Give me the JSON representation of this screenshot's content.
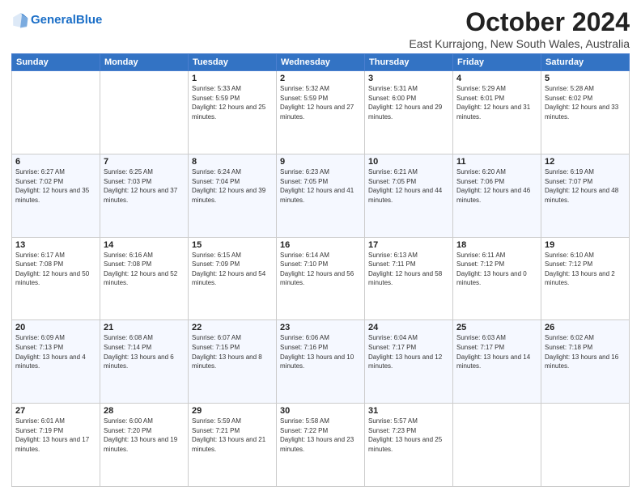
{
  "header": {
    "logo_line1": "General",
    "logo_line2": "Blue",
    "month_title": "October 2024",
    "location": "East Kurrajong, New South Wales, Australia"
  },
  "weekdays": [
    "Sunday",
    "Monday",
    "Tuesday",
    "Wednesday",
    "Thursday",
    "Friday",
    "Saturday"
  ],
  "weeks": [
    [
      {
        "day": "",
        "sunrise": "",
        "sunset": "",
        "daylight": ""
      },
      {
        "day": "",
        "sunrise": "",
        "sunset": "",
        "daylight": ""
      },
      {
        "day": "1",
        "sunrise": "Sunrise: 5:33 AM",
        "sunset": "Sunset: 5:59 PM",
        "daylight": "Daylight: 12 hours and 25 minutes."
      },
      {
        "day": "2",
        "sunrise": "Sunrise: 5:32 AM",
        "sunset": "Sunset: 5:59 PM",
        "daylight": "Daylight: 12 hours and 27 minutes."
      },
      {
        "day": "3",
        "sunrise": "Sunrise: 5:31 AM",
        "sunset": "Sunset: 6:00 PM",
        "daylight": "Daylight: 12 hours and 29 minutes."
      },
      {
        "day": "4",
        "sunrise": "Sunrise: 5:29 AM",
        "sunset": "Sunset: 6:01 PM",
        "daylight": "Daylight: 12 hours and 31 minutes."
      },
      {
        "day": "5",
        "sunrise": "Sunrise: 5:28 AM",
        "sunset": "Sunset: 6:02 PM",
        "daylight": "Daylight: 12 hours and 33 minutes."
      }
    ],
    [
      {
        "day": "6",
        "sunrise": "Sunrise: 6:27 AM",
        "sunset": "Sunset: 7:02 PM",
        "daylight": "Daylight: 12 hours and 35 minutes."
      },
      {
        "day": "7",
        "sunrise": "Sunrise: 6:25 AM",
        "sunset": "Sunset: 7:03 PM",
        "daylight": "Daylight: 12 hours and 37 minutes."
      },
      {
        "day": "8",
        "sunrise": "Sunrise: 6:24 AM",
        "sunset": "Sunset: 7:04 PM",
        "daylight": "Daylight: 12 hours and 39 minutes."
      },
      {
        "day": "9",
        "sunrise": "Sunrise: 6:23 AM",
        "sunset": "Sunset: 7:05 PM",
        "daylight": "Daylight: 12 hours and 41 minutes."
      },
      {
        "day": "10",
        "sunrise": "Sunrise: 6:21 AM",
        "sunset": "Sunset: 7:05 PM",
        "daylight": "Daylight: 12 hours and 44 minutes."
      },
      {
        "day": "11",
        "sunrise": "Sunrise: 6:20 AM",
        "sunset": "Sunset: 7:06 PM",
        "daylight": "Daylight: 12 hours and 46 minutes."
      },
      {
        "day": "12",
        "sunrise": "Sunrise: 6:19 AM",
        "sunset": "Sunset: 7:07 PM",
        "daylight": "Daylight: 12 hours and 48 minutes."
      }
    ],
    [
      {
        "day": "13",
        "sunrise": "Sunrise: 6:17 AM",
        "sunset": "Sunset: 7:08 PM",
        "daylight": "Daylight: 12 hours and 50 minutes."
      },
      {
        "day": "14",
        "sunrise": "Sunrise: 6:16 AM",
        "sunset": "Sunset: 7:08 PM",
        "daylight": "Daylight: 12 hours and 52 minutes."
      },
      {
        "day": "15",
        "sunrise": "Sunrise: 6:15 AM",
        "sunset": "Sunset: 7:09 PM",
        "daylight": "Daylight: 12 hours and 54 minutes."
      },
      {
        "day": "16",
        "sunrise": "Sunrise: 6:14 AM",
        "sunset": "Sunset: 7:10 PM",
        "daylight": "Daylight: 12 hours and 56 minutes."
      },
      {
        "day": "17",
        "sunrise": "Sunrise: 6:13 AM",
        "sunset": "Sunset: 7:11 PM",
        "daylight": "Daylight: 12 hours and 58 minutes."
      },
      {
        "day": "18",
        "sunrise": "Sunrise: 6:11 AM",
        "sunset": "Sunset: 7:12 PM",
        "daylight": "Daylight: 13 hours and 0 minutes."
      },
      {
        "day": "19",
        "sunrise": "Sunrise: 6:10 AM",
        "sunset": "Sunset: 7:12 PM",
        "daylight": "Daylight: 13 hours and 2 minutes."
      }
    ],
    [
      {
        "day": "20",
        "sunrise": "Sunrise: 6:09 AM",
        "sunset": "Sunset: 7:13 PM",
        "daylight": "Daylight: 13 hours and 4 minutes."
      },
      {
        "day": "21",
        "sunrise": "Sunrise: 6:08 AM",
        "sunset": "Sunset: 7:14 PM",
        "daylight": "Daylight: 13 hours and 6 minutes."
      },
      {
        "day": "22",
        "sunrise": "Sunrise: 6:07 AM",
        "sunset": "Sunset: 7:15 PM",
        "daylight": "Daylight: 13 hours and 8 minutes."
      },
      {
        "day": "23",
        "sunrise": "Sunrise: 6:06 AM",
        "sunset": "Sunset: 7:16 PM",
        "daylight": "Daylight: 13 hours and 10 minutes."
      },
      {
        "day": "24",
        "sunrise": "Sunrise: 6:04 AM",
        "sunset": "Sunset: 7:17 PM",
        "daylight": "Daylight: 13 hours and 12 minutes."
      },
      {
        "day": "25",
        "sunrise": "Sunrise: 6:03 AM",
        "sunset": "Sunset: 7:17 PM",
        "daylight": "Daylight: 13 hours and 14 minutes."
      },
      {
        "day": "26",
        "sunrise": "Sunrise: 6:02 AM",
        "sunset": "Sunset: 7:18 PM",
        "daylight": "Daylight: 13 hours and 16 minutes."
      }
    ],
    [
      {
        "day": "27",
        "sunrise": "Sunrise: 6:01 AM",
        "sunset": "Sunset: 7:19 PM",
        "daylight": "Daylight: 13 hours and 17 minutes."
      },
      {
        "day": "28",
        "sunrise": "Sunrise: 6:00 AM",
        "sunset": "Sunset: 7:20 PM",
        "daylight": "Daylight: 13 hours and 19 minutes."
      },
      {
        "day": "29",
        "sunrise": "Sunrise: 5:59 AM",
        "sunset": "Sunset: 7:21 PM",
        "daylight": "Daylight: 13 hours and 21 minutes."
      },
      {
        "day": "30",
        "sunrise": "Sunrise: 5:58 AM",
        "sunset": "Sunset: 7:22 PM",
        "daylight": "Daylight: 13 hours and 23 minutes."
      },
      {
        "day": "31",
        "sunrise": "Sunrise: 5:57 AM",
        "sunset": "Sunset: 7:23 PM",
        "daylight": "Daylight: 13 hours and 25 minutes."
      },
      {
        "day": "",
        "sunrise": "",
        "sunset": "",
        "daylight": ""
      },
      {
        "day": "",
        "sunrise": "",
        "sunset": "",
        "daylight": ""
      }
    ]
  ]
}
